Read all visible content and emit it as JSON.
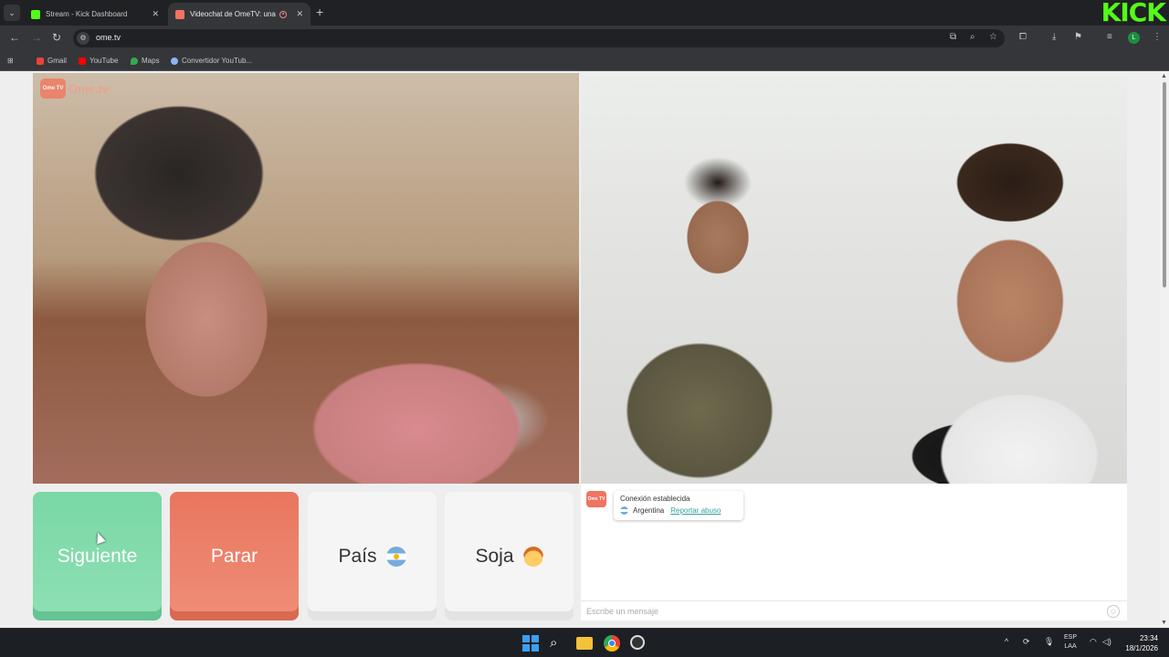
{
  "browser": {
    "tabs": [
      {
        "title": "Stream - Kick Dashboard",
        "active": false
      },
      {
        "title": "Videochat de OmeTV: una ",
        "active": true
      }
    ],
    "url": "ome.tv",
    "bookmarks": [
      "Gmail",
      "YouTube",
      "Maps",
      "Convertidor YouTub..."
    ],
    "profile_initial": "L",
    "overlay_logo": "KICK"
  },
  "page": {
    "watermark": {
      "badge": "Ome TV",
      "text": "Ome.tv"
    },
    "buttons": {
      "next": "Siguiente",
      "stop": "Parar",
      "country": "País",
      "gender": "Soja"
    },
    "chat": {
      "logo": "Ome TV",
      "status": "Conexión establecida",
      "country": "Argentina",
      "report": "Reportar abuso",
      "placeholder": "Escribe un mensaje"
    }
  },
  "taskbar": {
    "language": {
      "line1": "ESP",
      "line2": "LAA"
    },
    "time": "23:34",
    "date": "18/1/2026"
  },
  "colors": {
    "next_button": "#7ad7a6",
    "stop_button": "#e9765e",
    "kick_green": "#53fc18",
    "ome_brand": "#ef7461"
  }
}
